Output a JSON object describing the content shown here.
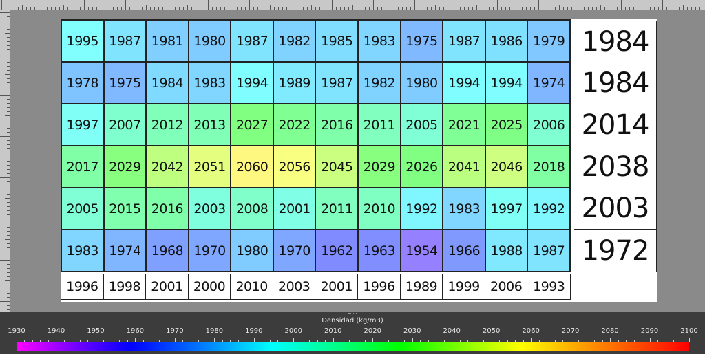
{
  "chart_data": {
    "type": "heatmap",
    "cells": [
      [
        "1995",
        "1987",
        "1981",
        "1980",
        "1987",
        "1982",
        "1985",
        "1983",
        "1975",
        "1987",
        "1986",
        "1979"
      ],
      [
        "1978",
        "1975",
        "1984",
        "1983",
        "1994",
        "1989",
        "1987",
        "1982",
        "1980",
        "1994",
        "1994",
        "1974"
      ],
      [
        "1997",
        "2007",
        "2012",
        "2013",
        "2027",
        "2022",
        "2016",
        "2011",
        "2005",
        "2021",
        "2025",
        "2006"
      ],
      [
        "2017",
        "2029",
        "2042",
        "2051",
        "2060",
        "2056",
        "2045",
        "2029",
        "2026",
        "2041",
        "2046",
        "2018"
      ],
      [
        "2005",
        "2015",
        "2016",
        "2003",
        "2008",
        "2001",
        "2011",
        "2010",
        "1992",
        "1983",
        "1997",
        "1992"
      ],
      [
        "1983",
        "1974",
        "1968",
        "1970",
        "1980",
        "1970",
        "1962",
        "1963",
        "1954",
        "1966",
        "1988",
        "1987"
      ]
    ],
    "column_averages": [
      "1996",
      "1998",
      "2001",
      "2000",
      "2010",
      "2003",
      "2001",
      "1996",
      "1989",
      "1999",
      "2006",
      "1993"
    ],
    "row_averages": [
      "1984",
      "1984",
      "2014",
      "2038",
      "2003",
      "1972"
    ],
    "colorbar": {
      "title": "Densidad (kg/m3)",
      "ticks": [
        "1930",
        "1940",
        "1950",
        "1960",
        "1970",
        "1980",
        "1990",
        "2000",
        "2010",
        "2020",
        "2030",
        "2040",
        "2050",
        "2060",
        "2070",
        "2080",
        "2090",
        "2100"
      ],
      "min": 1930,
      "max": 2100,
      "colors": [
        "#ff00ff",
        "#0000ff",
        "#00ffff",
        "#00ff00",
        "#ffff00",
        "#ff0000"
      ]
    }
  }
}
